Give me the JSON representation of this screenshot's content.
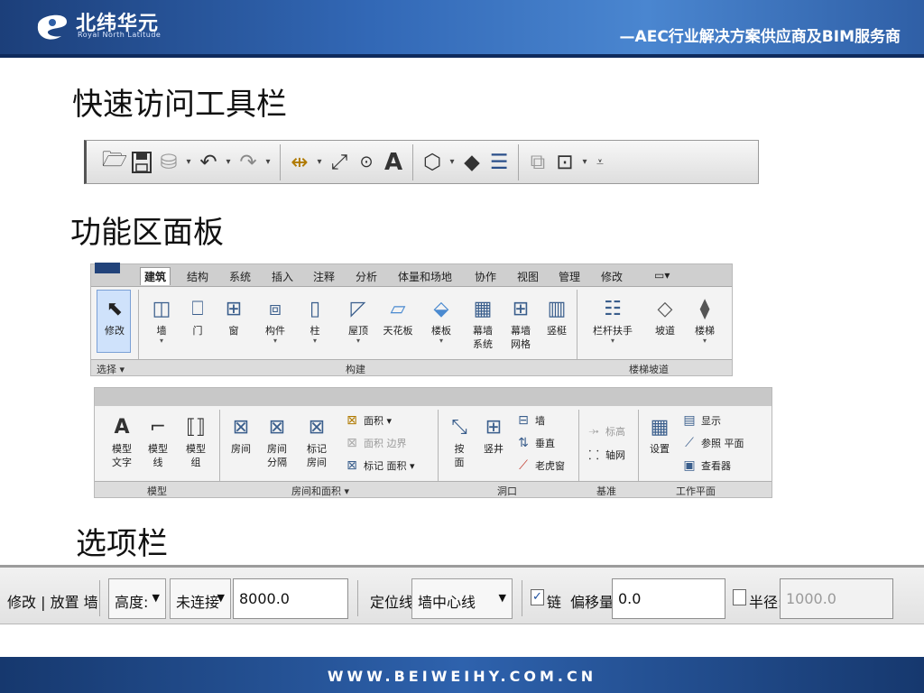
{
  "header": {
    "logo_cn": "北纬华元",
    "logo_en": "Royal North Latitude",
    "tagline": "—AEC行业解决方案供应商及BIM服务商"
  },
  "sections": {
    "qat_title": "快速访问工具栏",
    "ribbon_title": "功能区面板",
    "options_title": "选项栏"
  },
  "ribbon1": {
    "tabs": [
      "建筑",
      "结构",
      "系统",
      "插入",
      "注释",
      "分析",
      "体量和场地",
      "协作",
      "视图",
      "管理",
      "修改",
      "▭▾"
    ],
    "tools": {
      "modify": "修改",
      "wall": "墙",
      "door": "门",
      "window": "窗",
      "component": "构件",
      "column": "柱",
      "roof": "屋顶",
      "ceiling": "天花板",
      "floor": "楼板",
      "curtain_system_1": "幕墙",
      "curtain_system_2": "系统",
      "curtain_grid_1": "幕墙",
      "curtain_grid_2": "网格",
      "mullion": "竖梃",
      "railing": "栏杆扶手",
      "ramp": "坡道",
      "stair": "楼梯"
    },
    "groups": {
      "select": "选择 ▾",
      "build": "构建",
      "circulation": "楼梯坡道"
    }
  },
  "ribbon2": {
    "tools": {
      "model_text_1": "模型",
      "model_text_2": "文字",
      "model_line_1": "模型",
      "model_line_2": "线",
      "model_group_1": "模型",
      "model_group_2": "组",
      "room": "房间",
      "room_sep_1": "房间",
      "room_sep_2": "分隔",
      "tag_room_1": "标记",
      "tag_room_2": "房间",
      "area": "面积 ▾",
      "area_boundary": "面积 边界",
      "tag_area": "标记 面积 ▾",
      "by_face_1": "按",
      "by_face_2": "面",
      "shaft": "竖井",
      "wall_opening": "墙",
      "vertical": "垂直",
      "dormer": "老虎窗",
      "level": "标高",
      "grid": "轴网",
      "set": "设置",
      "show": "显示",
      "ref_plane": "参照 平面",
      "viewer": "查看器"
    },
    "groups": {
      "model": "模型",
      "room_area": "房间和面积 ▾",
      "opening": "洞口",
      "datum": "基准",
      "workplane": "工作平面"
    }
  },
  "options_bar": {
    "context": "修改 | 放置 墙",
    "height_mode": "高度:",
    "top_constraint": "未连接",
    "height_value": "8000.0",
    "location_label": "定位线:",
    "location_value": "墙中心线",
    "chain_label": "链",
    "chain_checked": "✓",
    "offset_label": "偏移量:",
    "offset_value": "0.0",
    "radius_label": "半径:",
    "radius_value": "1000.0"
  },
  "footer": {
    "url": "WWW.BEIWEIHY.COM.CN"
  }
}
